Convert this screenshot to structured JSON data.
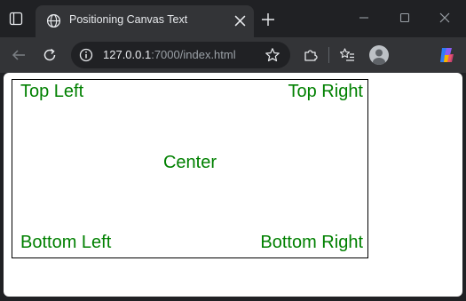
{
  "browser": {
    "tab_title": "Positioning Canvas Text",
    "url_host": "127.0.0.1",
    "url_rest": ":7000/index.html"
  },
  "canvas": {
    "border_color": "#000000",
    "text_color": "#008000",
    "labels": {
      "top_left": "Top Left",
      "top_right": "Top Right",
      "center": "Center",
      "bottom_left": "Bottom Left",
      "bottom_right": "Bottom Right"
    }
  },
  "icons": {
    "tab_actions": "tab-actions-icon",
    "globe": "globe-icon",
    "close": "close-icon",
    "new_tab": "plus-icon",
    "minimize": "minimize-icon",
    "maximize": "maximize-icon",
    "window_close": "window-close-icon",
    "back": "back-arrow-icon",
    "reload": "reload-icon",
    "site_info": "info-icon",
    "favorite": "star-icon",
    "extensions": "puzzle-icon",
    "favorites_list": "favorites-icon",
    "profile": "profile-avatar",
    "copilot": "copilot-icon"
  }
}
